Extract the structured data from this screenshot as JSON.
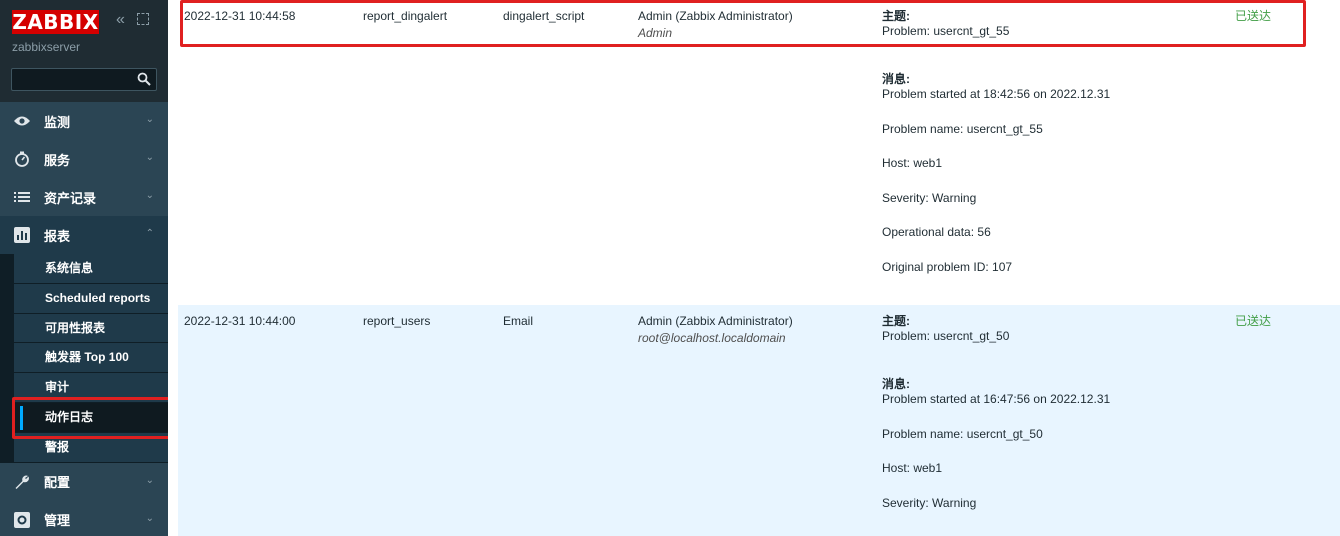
{
  "sidebar": {
    "logo": "ZABBIX",
    "server_name": "zabbixserver",
    "search_placeholder": "",
    "menu": [
      {
        "label": "监测",
        "icon": "eye-icon"
      },
      {
        "label": "服务",
        "icon": "stopwatch-icon"
      },
      {
        "label": "资产记录",
        "icon": "list-icon"
      },
      {
        "label": "报表",
        "icon": "bar-chart-icon"
      }
    ],
    "reports_submenu": [
      {
        "label": "系统信息"
      },
      {
        "label": "Scheduled reports"
      },
      {
        "label": "可用性报表"
      },
      {
        "label": "触发器 Top 100"
      },
      {
        "label": "审计"
      },
      {
        "label": "动作日志"
      },
      {
        "label": "警报"
      }
    ],
    "menu_bottom": [
      {
        "label": "配置",
        "icon": "wrench-icon"
      },
      {
        "label": "管理",
        "icon": "gear-icon"
      }
    ]
  },
  "table": {
    "rows": [
      {
        "time": "2022-12-31 10:44:58",
        "action": "report_dingalert",
        "media_type": "dingalert_script",
        "recipient": "Admin (Zabbix Administrator)",
        "recipient_sub": "Admin",
        "subject_label": "主题:",
        "subject": "Problem: usercnt_gt_55",
        "message_label": "消息:",
        "lines": [
          "Problem started at 18:42:56 on 2022.12.31",
          "Problem name: usercnt_gt_55",
          "Host: web1",
          "Severity: Warning",
          "Operational data: 56",
          "Original problem ID: 107"
        ],
        "status": "已送达"
      },
      {
        "time": "2022-12-31 10:44:00",
        "action": "report_users",
        "media_type": "Email",
        "recipient": "Admin (Zabbix Administrator)",
        "recipient_sub": "root@localhost.localdomain",
        "subject_label": "主题:",
        "subject": "Problem: usercnt_gt_50",
        "message_label": "消息:",
        "lines": [
          "Problem started at 16:47:56 on 2022.12.31",
          "Problem name: usercnt_gt_50",
          "Host: web1",
          "Severity: Warning"
        ],
        "status": "已送达"
      }
    ]
  },
  "colors": {
    "sidebar_bg": "#1f2c33",
    "logo_red": "#d40000",
    "status_green": "#429e47",
    "highlight_red": "#e02020",
    "row_alt_bg": "#e8f5ff"
  }
}
